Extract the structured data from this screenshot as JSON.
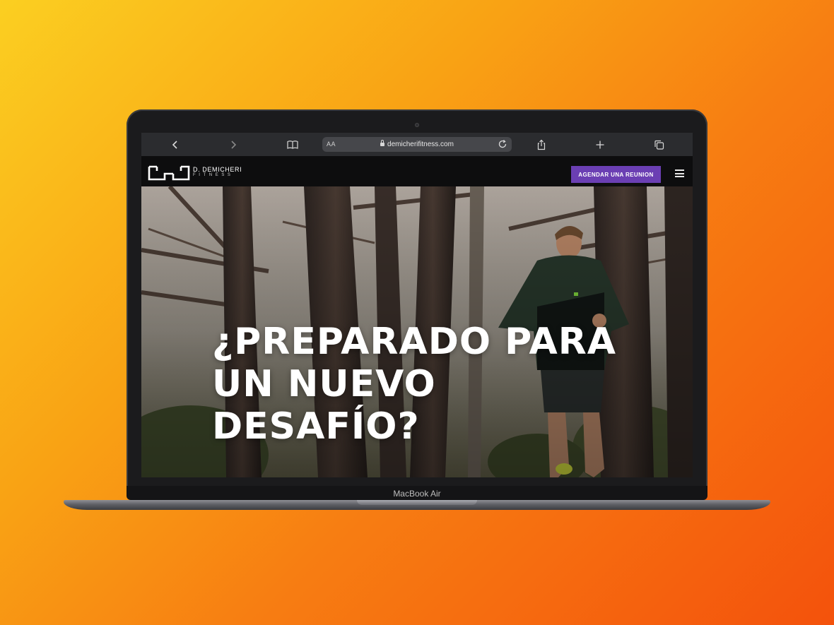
{
  "browser": {
    "text_size_label": "AA",
    "url": "demicherifitness.com",
    "icons": [
      "chevron-left-icon",
      "chevron-right-icon",
      "book-icon",
      "lock-icon",
      "reload-icon",
      "share-icon",
      "plus-icon",
      "tabs-icon"
    ]
  },
  "site": {
    "brand_name": "D. DEMICHERI",
    "brand_sub": "FITNESS",
    "cta_label": "AGENDAR UNA REUNION",
    "menu_icon": "hamburger-menu-icon",
    "accent_color": "#6b3fb3"
  },
  "hero": {
    "title_line1": "¿PREPARADO PARA",
    "title_line2": "UN NUEVO DESAFÍO?"
  },
  "device": {
    "model_label": "MacBook Air"
  }
}
